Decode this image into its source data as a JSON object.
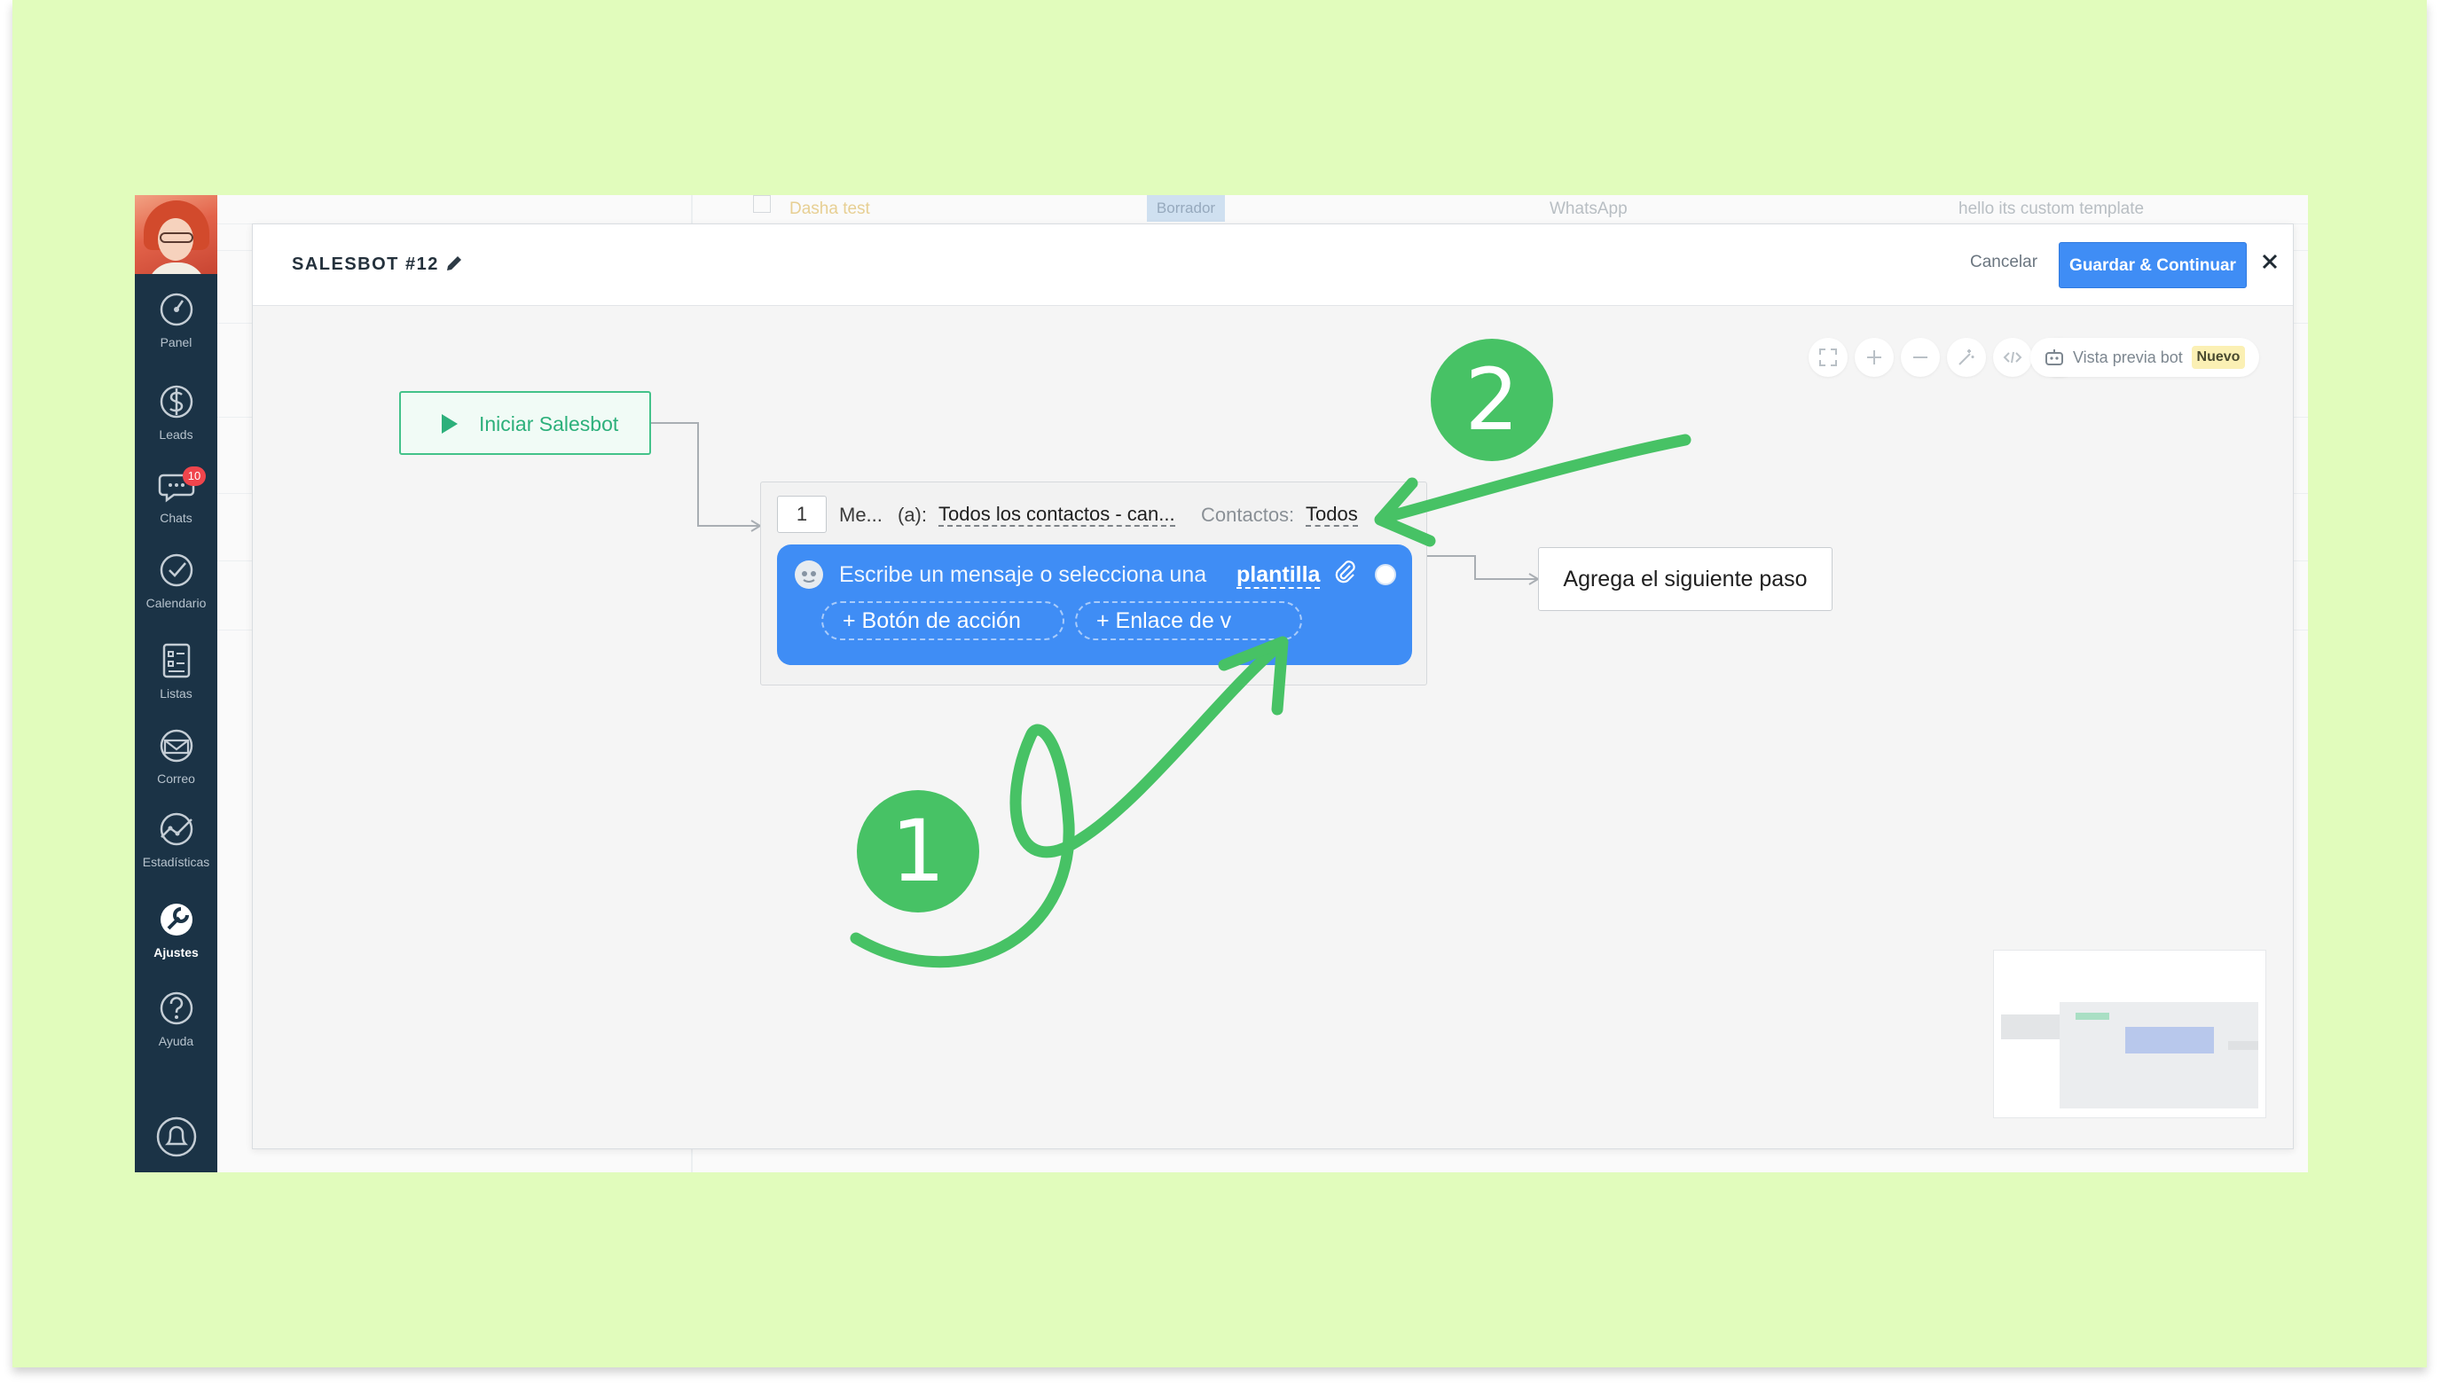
{
  "sidebar": {
    "items": [
      {
        "label": "Panel",
        "icon": "dashboard-icon"
      },
      {
        "label": "Leads",
        "icon": "dollar-icon"
      },
      {
        "label": "Chats",
        "icon": "chat-icon",
        "badge": "10"
      },
      {
        "label": "Calendario",
        "icon": "checkmark-icon"
      },
      {
        "label": "Listas",
        "icon": "list-icon"
      },
      {
        "label": "Correo",
        "icon": "mail-icon"
      },
      {
        "label": "Estadísticas",
        "icon": "stats-icon"
      },
      {
        "label": "Ajustes",
        "icon": "wrench-icon",
        "active": true
      },
      {
        "label": "Ayuda",
        "icon": "help-icon"
      }
    ]
  },
  "background_list": {
    "name": "Dasha test",
    "status": "Borrador",
    "channel": "WhatsApp",
    "template": "hello its custom template"
  },
  "modal": {
    "title": "SALESBOT #12",
    "cancel_label": "Cancelar",
    "save_label": "Guardar & Continuar"
  },
  "toolbar": {
    "preview_label": "Vista previa bot",
    "new_badge": "Nuevo"
  },
  "flow": {
    "start_label": "Iniciar Salesbot",
    "step": {
      "number": "1",
      "name": "Me...",
      "to_label": "(a):",
      "to_value": "Todos los contactos - can...",
      "contacts_label": "Contactos:",
      "contacts_value": "Todos",
      "message_placeholder": "Escribe un mensaje o selecciona una",
      "template_link": "plantilla",
      "action_button_label": "+ Botón de acción",
      "link_button_label": "+ Enlace de v"
    },
    "next_step_label": "Agrega el siguiente paso"
  },
  "annotations": {
    "marker_1": "1",
    "marker_2": "2",
    "color": "#47c265"
  },
  "colors": {
    "background": "#e1fcbc",
    "sidebar": "#1b3346",
    "accent_blue": "#3f8df5",
    "start_green": "#2db07b"
  }
}
